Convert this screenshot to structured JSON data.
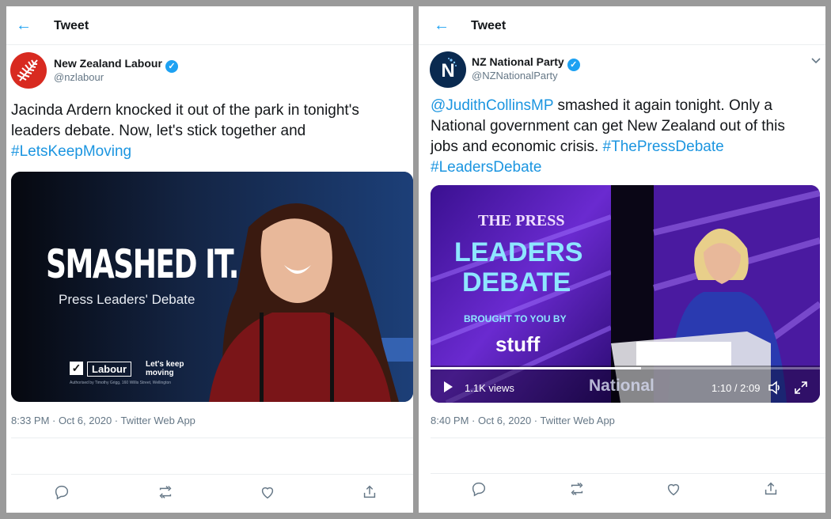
{
  "left": {
    "header_title": "Tweet",
    "author": {
      "name": "New Zealand Labour",
      "handle": "@nzlabour"
    },
    "text": {
      "line1": "Jacinda Ardern knocked it out of the park in tonight's",
      "line2": "leaders debate. Now, let's stick together and",
      "hashtag": "#LetsKeepMoving"
    },
    "media": {
      "headline": "SMASHED IT.",
      "subline": "Press Leaders' Debate",
      "brand": "Labour",
      "slogan": "Let's keep moving",
      "fineprint": "Authorised by Timothy Grigg, 160 Willis Street, Wellington"
    },
    "meta": "8:33 PM · Oct 6, 2020 · Twitter Web App"
  },
  "right": {
    "header_title": "Tweet",
    "author": {
      "name": "NZ National Party",
      "handle": "@NZNationalParty"
    },
    "text": {
      "mention": "@JudithCollinsMP",
      "line1_rest": " smashed it again tonight. Only a",
      "line2": "National government can get New Zealand out of this",
      "line3_text": "jobs and economic crisis. ",
      "hashtag1": "#ThePressDebate",
      "hashtag2": "#LeadersDebate"
    },
    "video": {
      "press_title": "THE PRESS",
      "debate_line1": "LEADERS",
      "debate_line2": "DEBATE",
      "brought_by": "BROUGHT TO YOU BY",
      "sponsor": "stuff",
      "views": "1.1K views",
      "watermark": "National",
      "time": "1:10 / 2:09",
      "progress": 0.54
    },
    "meta": "8:40 PM · Oct 6, 2020 · Twitter Web App"
  },
  "colors": {
    "link": "#1b95e0",
    "verified": "#1da1f2",
    "labour_red": "#d82a20",
    "national_navy": "#0a2a50"
  }
}
